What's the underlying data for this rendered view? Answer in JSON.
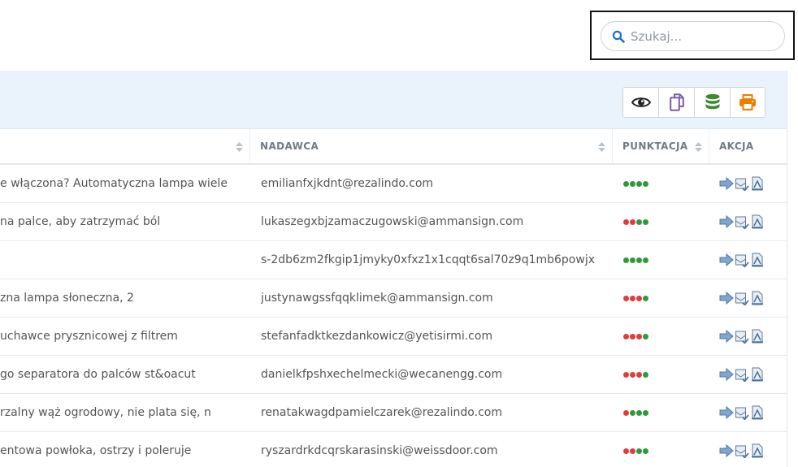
{
  "search": {
    "placeholder": "Szukaj..."
  },
  "toolbar": {
    "buttons": [
      {
        "name": "view-button",
        "icon": "eye-icon",
        "color": "#222222"
      },
      {
        "name": "copy-button",
        "icon": "copy-icon",
        "color": "#7a5ca8"
      },
      {
        "name": "database-button",
        "icon": "database-icon",
        "color": "#3c8a2e"
      },
      {
        "name": "print-button",
        "icon": "printer-icon",
        "color": "#ef7d00"
      }
    ]
  },
  "table": {
    "columns": {
      "subject": "",
      "sender": "NADAWCA",
      "score": "PUNKTACJA",
      "action": "AKCJA"
    },
    "rows": [
      {
        "subject": "e włączona? Automatyczna lampa wiele",
        "sender": "emilianfxjkdnt@rezalindo.com",
        "score": [
          "#2e9a3a",
          "#2e9a3a",
          "#2e9a3a",
          "#2e9a3a"
        ]
      },
      {
        "subject": "na palce, aby zatrzymać ból",
        "sender": "lukaszegxbjzamaczugowski@ammansign.com",
        "score": [
          "#e23b3b",
          "#e23b3b",
          "#2e9a3a",
          "#2e9a3a"
        ]
      },
      {
        "subject": "",
        "sender": "s-2db6zm2fkgip1jmyky0xfxz1x1cqqt6sal70z9q1mb6powjx",
        "score": [
          "#2e9a3a",
          "#2e9a3a",
          "#2e9a3a",
          "#2e9a3a"
        ]
      },
      {
        "subject": "zna lampa słoneczna, 2",
        "sender": "justynawgssfqqklimek@ammansign.com",
        "score": [
          "#e23b3b",
          "#e23b3b",
          "#e23b3b",
          "#2e9a3a"
        ]
      },
      {
        "subject": "uchawce prysznicowej z filtrem",
        "sender": "stefanfadktkezdankowicz@yetisirmi.com",
        "score": [
          "#e23b3b",
          "#e23b3b",
          "#e23b3b",
          "#2e9a3a"
        ]
      },
      {
        "subject": "go separatora do palców st&oacut",
        "sender": "danielkfpshxechelmecki@wecanengg.com",
        "score": [
          "#e23b3b",
          "#e23b3b",
          "#e23b3b",
          "#2e9a3a"
        ]
      },
      {
        "subject": "rzalny wąż ogrodowy, nie plata się, n",
        "sender": "renatakwagdpamielczarek@rezalindo.com",
        "score": [
          "#e23b3b",
          "#2e9a3a",
          "#2e9a3a",
          "#2e9a3a"
        ]
      },
      {
        "subject": "entowa powłoka, ostrzy i poleruje",
        "sender": "ryszardrkdcqrskarasinski@weissdoor.com",
        "score": [
          "#e23b3b",
          "#e23b3b",
          "#2e9a3a",
          "#2e9a3a"
        ]
      }
    ],
    "row_actions": [
      {
        "name": "forward-button",
        "icon": "arrow-right-icon"
      },
      {
        "name": "release-button",
        "icon": "mail-check-icon"
      },
      {
        "name": "report-button",
        "icon": "report-icon"
      }
    ]
  }
}
